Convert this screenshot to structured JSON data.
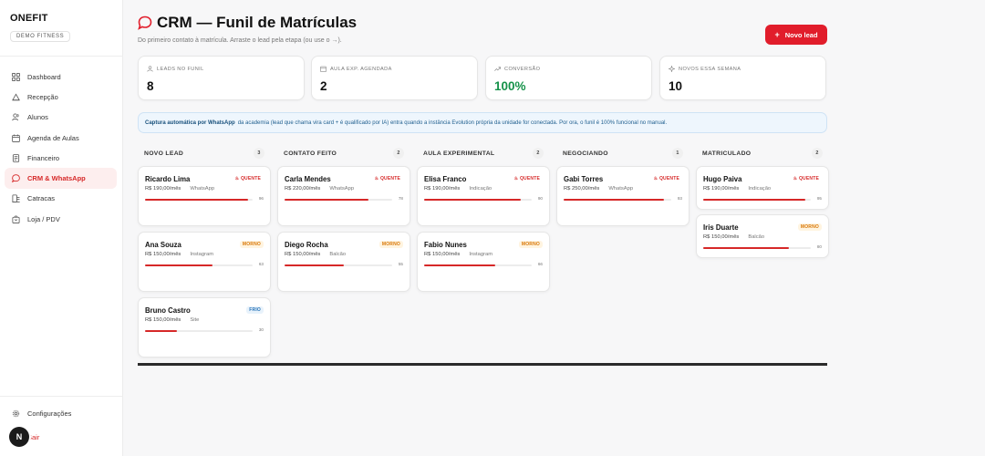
{
  "brand": {
    "name": "ONEFIT",
    "sub": "DEMO FITNESS"
  },
  "nav": [
    {
      "label": "Dashboard",
      "icon": "grid-icon"
    },
    {
      "label": "Recepção",
      "icon": "bell-icon"
    },
    {
      "label": "Alunos",
      "icon": "users-icon"
    },
    {
      "label": "Agenda de Aulas",
      "icon": "calendar-icon"
    },
    {
      "label": "Financeiro",
      "icon": "receipt-icon"
    },
    {
      "label": "CRM & WhatsApp",
      "icon": "chat-icon"
    },
    {
      "label": "Catracas",
      "icon": "turnstile-icon"
    },
    {
      "label": "Loja / PDV",
      "icon": "bag-icon"
    }
  ],
  "settings_label": "Configurações",
  "logout_label": "Sair",
  "avatar_letter": "N",
  "header": {
    "title": "CRM — Funil de Matrículas",
    "subtitle": "Do primeiro contato à matrícula. Arraste o lead pela etapa (ou use o →).",
    "new_lead": "Novo lead"
  },
  "stats": [
    {
      "label": "LEADS NO FUNIL",
      "value": "8"
    },
    {
      "label": "AULA EXP. AGENDADA",
      "value": "2"
    },
    {
      "label": "CONVERSÃO",
      "value": "100%"
    },
    {
      "label": "NOVOS ESSA SEMANA",
      "value": "10"
    }
  ],
  "banner": {
    "bold": "Captura automática por WhatsApp",
    "text": "da academia (lead que chama vira card + é qualificado por IA) entra quando a instância Evolution própria da unidade for conectada. Por ora, o funil é 100% funcional no manual."
  },
  "columns": [
    {
      "title": "NOVO LEAD",
      "count": "3",
      "cards": [
        {
          "name": "Ricardo Lima",
          "price": "R$ 190,00/mês",
          "source": "WhatsApp",
          "badge": "QUENTE",
          "score": 96
        },
        {
          "name": "Ana Souza",
          "price": "R$ 150,00/mês",
          "source": "Instagram",
          "badge": "MORNO",
          "score": 63
        },
        {
          "name": "Bruno Castro",
          "price": "R$ 150,00/mês",
          "source": "Site",
          "badge": "FRIO",
          "score": 30
        }
      ]
    },
    {
      "title": "CONTATO FEITO",
      "count": "2",
      "cards": [
        {
          "name": "Carla Mendes",
          "price": "R$ 220,00/mês",
          "source": "WhatsApp",
          "badge": "QUENTE",
          "score": 78
        },
        {
          "name": "Diego Rocha",
          "price": "R$ 150,00/mês",
          "source": "Balcão",
          "badge": "MORNO",
          "score": 55
        }
      ]
    },
    {
      "title": "AULA EXPERIMENTAL",
      "count": "2",
      "cards": [
        {
          "name": "Elisa Franco",
          "price": "R$ 190,00/mês",
          "source": "Indicação",
          "badge": "QUENTE",
          "score": 90
        },
        {
          "name": "Fabio Nunes",
          "price": "R$ 150,00/mês",
          "source": "Instagram",
          "badge": "MORNO",
          "score": 66
        }
      ]
    },
    {
      "title": "NEGOCIANDO",
      "count": "1",
      "cards": [
        {
          "name": "Gabi Torres",
          "price": "R$ 250,00/mês",
          "source": "WhatsApp",
          "badge": "QUENTE",
          "score": 93
        }
      ]
    },
    {
      "title": "MATRICULADO",
      "count": "2",
      "cards": [
        {
          "name": "Hugo Paiva",
          "price": "R$ 190,00/mês",
          "source": "Indicação",
          "badge": "QUENTE",
          "score": 95
        },
        {
          "name": "Iris Duarte",
          "price": "R$ 150,00/mês",
          "source": "Balcão",
          "badge": "MORNO",
          "score": 80
        }
      ]
    }
  ]
}
